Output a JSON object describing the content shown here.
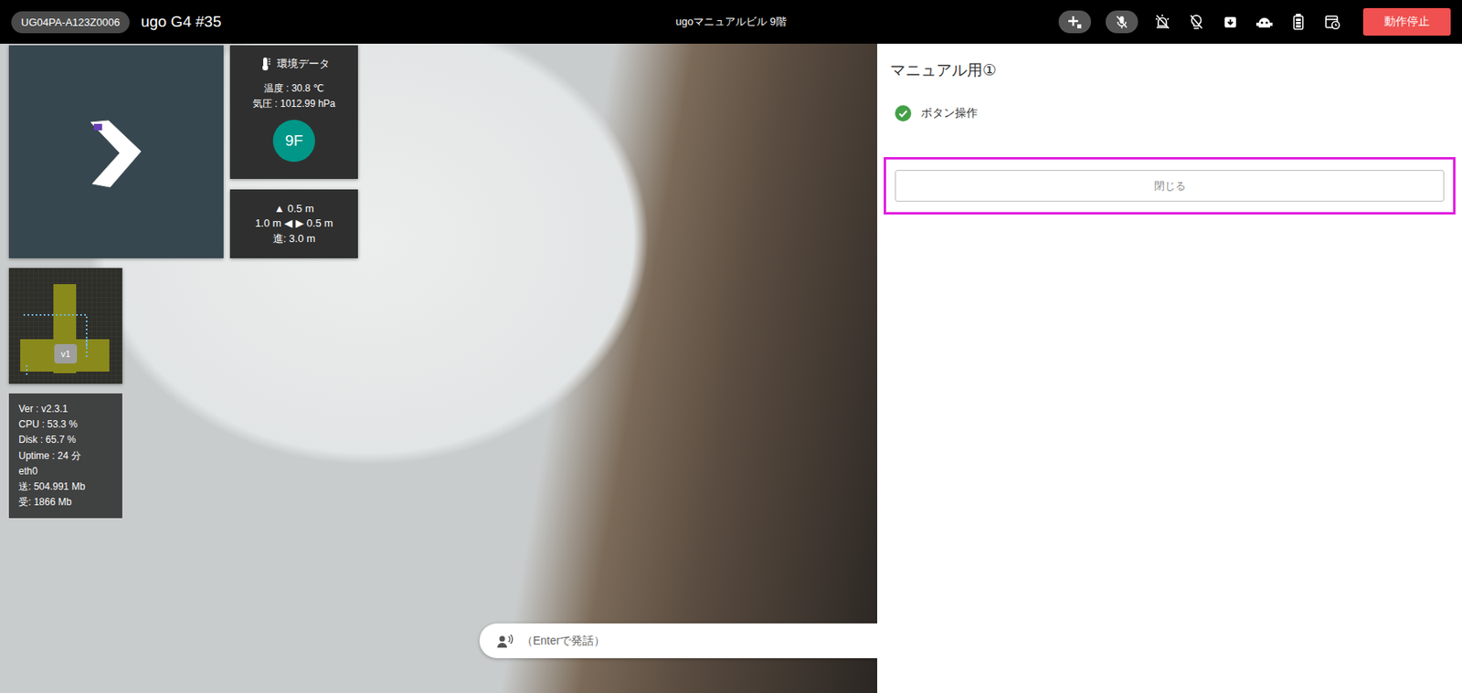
{
  "header": {
    "robot_id": "UG04PA-A123Z0006",
    "robot_name": "ugo G4 #35",
    "location": "ugoマニュアルビル 9階",
    "stop_button": "動作停止"
  },
  "environment": {
    "title": "環境データ",
    "temperature": "温度 : 30.8 ℃",
    "pressure": "気圧 : 1012.99 hPa",
    "floor": "9F"
  },
  "distance": {
    "up": "▲ 0.5 m",
    "left": "1.0 m ◀",
    "right": "▶ 0.5 m",
    "forward": "進: 3.0 m"
  },
  "minimap": {
    "badge": "v1"
  },
  "stats": [
    "Ver : v2.3.1",
    "CPU : 53.3 %",
    "Disk : 65.7 %",
    "Uptime : 24 分",
    "eth0",
    "送: 504.991 Mb",
    "受: 1866 Mb"
  ],
  "speech": {
    "placeholder": "（Enterで発話）"
  },
  "panel": {
    "title": "マニュアル用①",
    "steps": [
      {
        "label": "ボタン操作",
        "done": true
      }
    ],
    "close_button": "閉じる",
    "close_highlighted": true
  }
}
